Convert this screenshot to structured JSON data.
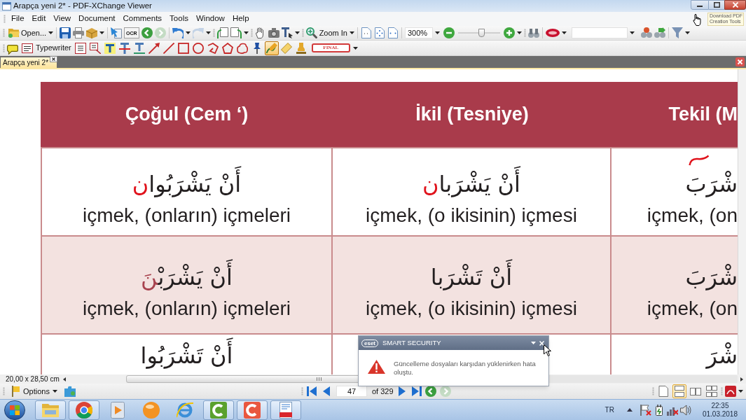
{
  "window": {
    "title": "Arapça yeni 2* - PDF-XChange Viewer"
  },
  "menu": [
    "File",
    "Edit",
    "View",
    "Document",
    "Comments",
    "Tools",
    "Window",
    "Help"
  ],
  "download_button": {
    "label": "Download PDF Creation Tools"
  },
  "toolbar_1": {
    "open_label": "Open...",
    "ocr_label": "OCR",
    "history": [
      {
        "disabled": false
      },
      {
        "disabled": true
      }
    ],
    "edit_history": [
      {
        "disabled": false
      },
      {
        "disabled": true
      }
    ],
    "zoom_label": "Zoom In",
    "zoom_value": "300%",
    "zoom_slider": {
      "level": 0.55
    }
  },
  "toolbar_2": {
    "tools": [
      {
        "selected": false
      },
      {
        "label": "Typewriter",
        "selected": false
      },
      {
        "selected": false
      },
      {
        "selected": false
      },
      {
        "selected": false
      },
      {
        "selected": false
      },
      {
        "selected": false
      },
      {
        "selected": false
      },
      {
        "selected": false
      },
      {
        "selected": false
      },
      {
        "selected": false
      },
      {
        "selected": false
      },
      {
        "selected": false
      },
      {
        "selected": false
      },
      {
        "selected": false
      },
      {
        "selected": true
      },
      {
        "selected": false
      },
      {
        "selected": false
      }
    ],
    "stamp_preview": "FINAL"
  },
  "document": {
    "tab": {
      "label": "Arapça yeni 2*"
    },
    "table": {
      "columns": [
        "Çoğul (Cem ‘)",
        "İkil (Tesniye)",
        "Tekil (M"
      ],
      "rows": [
        {
          "cells": [
            {
              "arabic": [
                {
                  "text": "أَنْ يَشْرَبُوا",
                  "kind": "print"
                },
                {
                  "text": "ن",
                  "kind": "ink"
                }
              ],
              "meaning": "içmek, (onların) içmeleri"
            },
            {
              "arabic": [
                {
                  "text": "أَنْ يَشْرَبا",
                  "kind": "print"
                },
                {
                  "text": "ن",
                  "kind": "ink"
                }
              ],
              "meaning": "içmek, (o ikisinin) içmesi"
            },
            {
              "arabic": [
                {
                  "text": "شْرَبَ",
                  "kind": "print"
                }
              ],
              "meaning": "içmek, (on",
              "ink_stroke": true
            }
          ]
        },
        {
          "cells": [
            {
              "arabic": [
                {
                  "text": "أَنْ يَشْرَبْ",
                  "kind": "print"
                },
                {
                  "text": "نَ",
                  "kind": "accent"
                }
              ],
              "meaning": "içmek, (onların) içmeleri"
            },
            {
              "arabic": [
                {
                  "text": "أَنْ تَشْرَبا",
                  "kind": "print"
                }
              ],
              "meaning": "içmek, (o ikisinin) içmesi"
            },
            {
              "arabic": [
                {
                  "text": "شْرَبَ",
                  "kind": "print"
                }
              ],
              "meaning": "içmek, (on"
            }
          ]
        },
        {
          "cells": [
            {
              "arabic": [
                {
                  "text": "أَنْ تَشْرَبُوا",
                  "kind": "print"
                }
              ]
            },
            {},
            {
              "arabic": [
                {
                  "text": "شْرَ",
                  "kind": "print"
                }
              ]
            }
          ]
        }
      ]
    }
  },
  "status": {
    "page_size": "20,00 x 28,50 cm"
  },
  "bottom_toolbar": {
    "options_label": "Options",
    "page": "47",
    "page_count": "of 329",
    "history": [
      {
        "disabled": false
      },
      {
        "disabled": true
      }
    ],
    "view_modes": [
      {
        "selected": false
      },
      {
        "selected": true
      },
      {
        "selected": false
      },
      {
        "selected": false
      }
    ]
  },
  "popup": {
    "brand": "eset",
    "title": "SMART SECURITY",
    "message": "Güncelleme dosyaları karşıdan yüklenirken hata oluştu."
  },
  "taskbar": {
    "apps": [
      {
        "running": true
      },
      {
        "running": true
      },
      {
        "running": false
      },
      {
        "running": false
      },
      {
        "running": false
      },
      {
        "running": true
      },
      {
        "running": true
      },
      {
        "running": true
      }
    ],
    "language": "TR",
    "time": "22:35",
    "date": "01.03.2018"
  }
}
